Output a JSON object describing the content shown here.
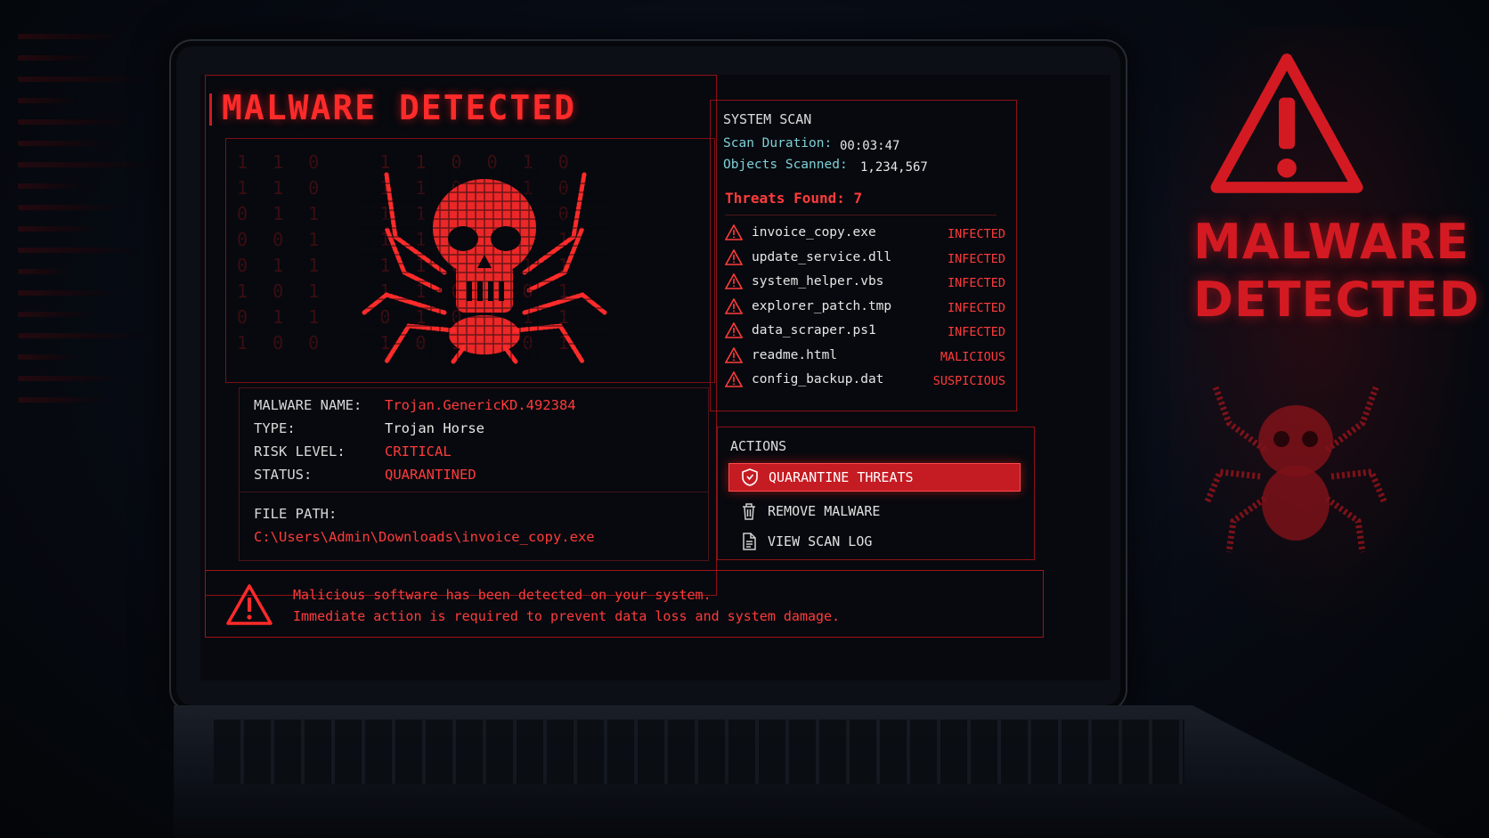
{
  "background": {
    "text_lines": [
      "MALWARE",
      "DETECTED"
    ],
    "accent_color": "#d31a22"
  },
  "main": {
    "title": "MALWARE DETECTED",
    "matrix_digits": "1 1 0   1 1 0 0 1 0\n1 1 0   1 1 0 1 1 0\n0 1 1   1 1 0 0 1 0\n0 0 1   1 1 1 0 0 1\n0 1 1   1 1 0 0 1 1\n1 0 1   1 1 0 1 0 1\n0 1 1   0 1 0 1 1 1\n1 0 0   1 0 1 1 0 1",
    "details": [
      {
        "label": "MALWARE NAME:",
        "value": "Trojan.GenericKD.492384",
        "color": "red"
      },
      {
        "label": "TYPE:",
        "value": "Trojan Horse",
        "color": "white"
      },
      {
        "label": "RISK LEVEL:",
        "value": "CRITICAL",
        "color": "red"
      },
      {
        "label": "STATUS:",
        "value": "QUARANTINED",
        "color": "red"
      }
    ],
    "file_path_label": "FILE PATH:",
    "file_path": "C:\\Users\\Admin\\Downloads\\invoice_copy.exe"
  },
  "scan": {
    "title": "SYSTEM SCAN",
    "duration_label": "Scan Duration:",
    "duration_value": "00:03:47",
    "objects_label": "Objects Scanned:",
    "objects_value": "1,234,567",
    "threats_found": "Threats Found: 7",
    "threats": [
      {
        "name": "invoice_copy.exe",
        "status": "INFECTED"
      },
      {
        "name": "update_service.dll",
        "status": "INFECTED"
      },
      {
        "name": "system_helper.vbs",
        "status": "INFECTED"
      },
      {
        "name": "explorer_patch.tmp",
        "status": "INFECTED"
      },
      {
        "name": "data_scraper.ps1",
        "status": "INFECTED"
      },
      {
        "name": "readme.html",
        "status": "MALICIOUS"
      },
      {
        "name": "config_backup.dat",
        "status": "SUSPICIOUS"
      }
    ]
  },
  "actions": {
    "title": "ACTIONS",
    "quarantine": "QUARANTINE THREATS",
    "remove": "REMOVE MALWARE",
    "view_log": "VIEW SCAN LOG"
  },
  "alert": {
    "line1": "Malicious software has been detected on your system.",
    "line2": "Immediate action is required to prevent data loss and system damage."
  },
  "icons": {
    "warning": "warning-triangle-icon",
    "spider": "spider-skull-icon",
    "shield": "shield-icon",
    "trash": "trash-icon",
    "document": "document-icon"
  }
}
